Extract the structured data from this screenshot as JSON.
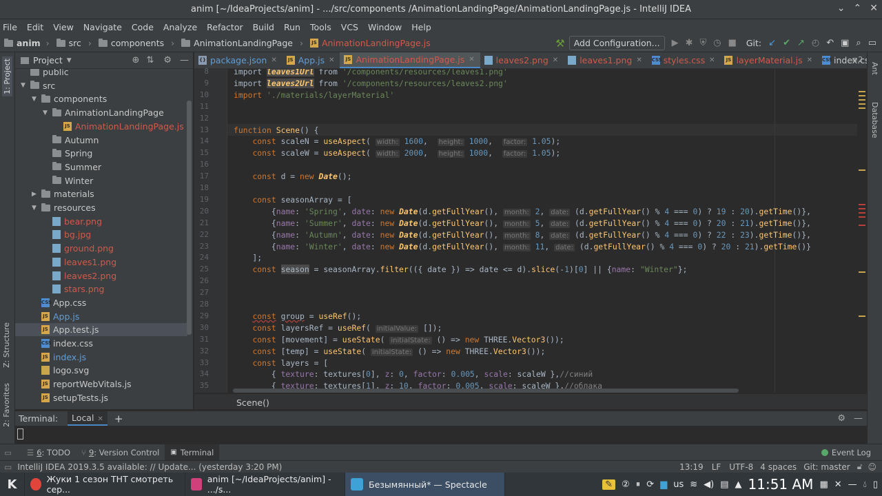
{
  "window": {
    "title": "anim [~/IdeaProjects/anim] - .../src/components /AnimationLandingPage/AnimationLandingPage.js - IntelliJ IDEA",
    "controls": [
      "⌄",
      "⌃",
      "✕"
    ]
  },
  "menu": [
    "File",
    "Edit",
    "View",
    "Navigate",
    "Code",
    "Analyze",
    "Refactor",
    "Build",
    "Run",
    "Tools",
    "VCS",
    "Window",
    "Help"
  ],
  "navbar": {
    "crumbs": [
      "anim",
      "src",
      "components",
      "AnimationLandingPage",
      "AnimationLandingPage.js"
    ],
    "add_configuration": "Add Configuration...",
    "git_label": "Git:"
  },
  "left_strip": {
    "project": "1: Project",
    "structure": "Z: Structure",
    "favorites": "2: Favorites"
  },
  "right_strip": {
    "ant": "Ant",
    "database": "Database"
  },
  "project_panel": {
    "title": "Project",
    "tree": [
      {
        "label": "public",
        "depth": 1,
        "kind": "folder",
        "color": "normal",
        "arrow": ""
      },
      {
        "label": "src",
        "depth": 1,
        "kind": "folder",
        "color": "normal",
        "arrow": "▼"
      },
      {
        "label": "components",
        "depth": 2,
        "kind": "folder",
        "color": "normal",
        "arrow": "▼"
      },
      {
        "label": "AnimationLandingPage",
        "depth": 3,
        "kind": "folder",
        "color": "normal",
        "arrow": "▼"
      },
      {
        "label": "AnimationLandingPage.js",
        "depth": 4,
        "kind": "js",
        "color": "red",
        "arrow": ""
      },
      {
        "label": "Autumn",
        "depth": 3,
        "kind": "folder",
        "color": "normal",
        "arrow": ""
      },
      {
        "label": "Spring",
        "depth": 3,
        "kind": "folder",
        "color": "normal",
        "arrow": ""
      },
      {
        "label": "Summer",
        "depth": 3,
        "kind": "folder",
        "color": "normal",
        "arrow": ""
      },
      {
        "label": "Winter",
        "depth": 3,
        "kind": "folder",
        "color": "normal",
        "arrow": ""
      },
      {
        "label": "materials",
        "depth": 2,
        "kind": "folder",
        "color": "normal",
        "arrow": "▶"
      },
      {
        "label": "resources",
        "depth": 2,
        "kind": "folder",
        "color": "normal",
        "arrow": "▼"
      },
      {
        "label": "bear.png",
        "depth": 3,
        "kind": "img",
        "color": "red",
        "arrow": ""
      },
      {
        "label": "bg.jpg",
        "depth": 3,
        "kind": "img",
        "color": "red",
        "arrow": ""
      },
      {
        "label": "ground.png",
        "depth": 3,
        "kind": "img",
        "color": "red",
        "arrow": ""
      },
      {
        "label": "leaves1.png",
        "depth": 3,
        "kind": "img",
        "color": "red",
        "arrow": ""
      },
      {
        "label": "leaves2.png",
        "depth": 3,
        "kind": "img",
        "color": "red",
        "arrow": ""
      },
      {
        "label": "stars.png",
        "depth": 3,
        "kind": "img",
        "color": "red",
        "arrow": ""
      },
      {
        "label": "App.css",
        "depth": 2,
        "kind": "css",
        "color": "normal",
        "arrow": ""
      },
      {
        "label": "App.js",
        "depth": 2,
        "kind": "js",
        "color": "blue",
        "arrow": ""
      },
      {
        "label": "App.test.js",
        "depth": 2,
        "kind": "js",
        "color": "normal",
        "arrow": "",
        "selected": true
      },
      {
        "label": "index.css",
        "depth": 2,
        "kind": "css",
        "color": "normal",
        "arrow": ""
      },
      {
        "label": "index.js",
        "depth": 2,
        "kind": "js",
        "color": "blue",
        "arrow": ""
      },
      {
        "label": "logo.svg",
        "depth": 2,
        "kind": "svg",
        "color": "normal",
        "arrow": ""
      },
      {
        "label": "reportWebVitals.js",
        "depth": 2,
        "kind": "js",
        "color": "normal",
        "arrow": ""
      },
      {
        "label": "setupTests.js",
        "depth": 2,
        "kind": "js",
        "color": "normal",
        "arrow": ""
      }
    ]
  },
  "tabs": [
    {
      "label": "package.json",
      "color": "blue",
      "kind": "json"
    },
    {
      "label": "App.js",
      "color": "blue",
      "kind": "js"
    },
    {
      "label": "AnimationLandingPage.js",
      "color": "red",
      "kind": "js",
      "active": true
    },
    {
      "label": "leaves2.png",
      "color": "red",
      "kind": "img"
    },
    {
      "label": "leaves1.png",
      "color": "red",
      "kind": "img"
    },
    {
      "label": "styles.css",
      "color": "red",
      "kind": "css"
    },
    {
      "label": "layerMaterial.js",
      "color": "red",
      "kind": "js"
    },
    {
      "label": "index.css",
      "color": "normal",
      "kind": "css"
    }
  ],
  "tabs_overflow": "≡2",
  "line_numbers": [
    8,
    9,
    10,
    11,
    12,
    13,
    14,
    15,
    16,
    17,
    18,
    19,
    20,
    21,
    22,
    23,
    24,
    25,
    26,
    27,
    28,
    29,
    30,
    31,
    32,
    33,
    34,
    35
  ],
  "code_lines": [
    "import <span class=\"hlv it\">leaves1Url</span> from <span class=\"str\">'/components/resources/leaves1.png'</span>",
    "import <span class=\"hlv it\">leaves2Url</span> from <span class=\"str\">'/components/resources/leaves2.png'</span>",
    "<span class=\"kw\">import</span> <span class=\"str\">'./materials/layerMaterial'</span>",
    "",
    "",
    "<span class=\"kw\">function</span> <span class=\"fn\">Scene</span>() {",
    "    <span class=\"kw\">const</span> scaleN = <span class=\"fn\">useAspect</span>( <span class=\"hint\">width:</span> <span class=\"num\">1600</span>,  <span class=\"hint\">height:</span> <span class=\"num\">1000</span>,  <span class=\"hint\">factor:</span> <span class=\"num\">1.05</span>);",
    "    <span class=\"kw\">const</span> scaleW = <span class=\"fn\">useAspect</span>( <span class=\"hint\">width:</span> <span class=\"num\">2000</span>,  <span class=\"hint\">height:</span> <span class=\"num\">1000</span>,  <span class=\"hint\">factor:</span> <span class=\"num\">1.05</span>);",
    "",
    "    <span class=\"kw\">const</span> d = <span class=\"kw\">new</span> <span class=\"it\">Date</span>();",
    "",
    "    <span class=\"kw\">const</span> seasonArray = [",
    "        {<span class=\"prop\">name</span>: <span class=\"str\">'Spring'</span>, <span class=\"prop\">date</span>: <span class=\"kw\">new</span> <span class=\"it\">Date</span>(d.<span class=\"fn\">getFullYear</span>(), <span class=\"hint\">month:</span> <span class=\"num\">2</span>, <span class=\"hint\">date:</span> (d.<span class=\"fn\">getFullYear</span>() % <span class=\"num\">4</span> === <span class=\"num\">0</span>) ? <span class=\"num\">19</span> : <span class=\"num\">20</span>).<span class=\"fn\">getTime</span>()},",
    "        {<span class=\"prop\">name</span>: <span class=\"str\">'Summer'</span>, <span class=\"prop\">date</span>: <span class=\"kw\">new</span> <span class=\"it\">Date</span>(d.<span class=\"fn\">getFullYear</span>(), <span class=\"hint\">month:</span> <span class=\"num\">5</span>, <span class=\"hint\">date:</span> (d.<span class=\"fn\">getFullYear</span>() % <span class=\"num\">4</span> === <span class=\"num\">0</span>) ? <span class=\"num\">20</span> : <span class=\"num\">21</span>).<span class=\"fn\">getTime</span>()},",
    "        {<span class=\"prop\">name</span>: <span class=\"str\">'Autumn'</span>, <span class=\"prop\">date</span>: <span class=\"kw\">new</span> <span class=\"it\">Date</span>(d.<span class=\"fn\">getFullYear</span>(), <span class=\"hint\">month:</span> <span class=\"num\">8</span>, <span class=\"hint\">date:</span> (d.<span class=\"fn\">getFullYear</span>() % <span class=\"num\">4</span> === <span class=\"num\">0</span>) ? <span class=\"num\">22</span> : <span class=\"num\">23</span>).<span class=\"fn\">getTime</span>()},",
    "        {<span class=\"prop\">name</span>: <span class=\"str\">'Winter'</span>, <span class=\"prop\">date</span>: <span class=\"kw\">new</span> <span class=\"it\">Date</span>(d.<span class=\"fn\">getFullYear</span>(), <span class=\"hint\">month:</span> <span class=\"num\">11</span>, <span class=\"hint\">date:</span> (d.<span class=\"fn\">getFullYear</span>() % <span class=\"num\">4</span> === <span class=\"num\">0</span>) ? <span class=\"num\">20</span> : <span class=\"num\">21</span>).<span class=\"fn\">getTime</span>()}",
    "    ];",
    "    <span class=\"kw\">const</span> <span class=\"hlv\">season</span> = seasonArray.<span class=\"fn\">filter</span>(({ date }) => date <= d).<span class=\"fn\">slice</span>(-<span class=\"num\">1</span>)[<span class=\"num\">0</span>] || {<span class=\"prop\">name</span>: <span class=\"str\">\"Winter\"</span>};",
    "",
    "",
    "",
    "    <span class=\"kw und\">const</span> <span class=\"und\">group</span> = <span class=\"fn\">useRef</span>();",
    "    <span class=\"kw\">const</span> layersRef = <span class=\"fn\">useRef</span>( <span class=\"hint\">initialValue:</span> []);",
    "    <span class=\"kw\">const</span> [movement] = <span class=\"fn\">useState</span>( <span class=\"hint\">initialState:</span> () => <span class=\"kw\">new</span> THREE.<span class=\"fn\">Vector3</span>());",
    "    <span class=\"kw\">const</span> [temp] = <span class=\"fn\">useState</span>( <span class=\"hint\">initialState:</span> () => <span class=\"kw\">new</span> THREE.<span class=\"fn\">Vector3</span>());",
    "    <span class=\"kw\">const</span> layers = [",
    "        { <span class=\"prop\">texture</span>: textures[<span class=\"num\">0</span>], <span class=\"prop\">z</span>: <span class=\"num\">0</span>, <span class=\"prop\">factor</span>: <span class=\"num\">0.005</span>, <span class=\"prop\">scale</span>: scaleW },<span class=\"cmt\">//синий</span>",
    "        { <span class=\"prop\">texture</span>: textures[<span class=\"num\">1</span>], <span class=\"prop\">z</span>: <span class=\"num\">10</span>, <span class=\"prop\">factor</span>: <span class=\"num\">0.005</span>, <span class=\"prop\">scale</span>: scaleW },<span class=\"cmt\">//облака</span>"
  ],
  "editor_breadcrumb": "Scene()",
  "terminal": {
    "title": "Terminal:",
    "tab": "Local"
  },
  "tool_windows": [
    {
      "num": "6",
      "label": ": TODO"
    },
    {
      "num": "9",
      "label": ": Version Control"
    },
    {
      "num": "",
      "label": "Terminal",
      "active": true
    }
  ],
  "event_log": "Event Log",
  "status": {
    "message": "IntelliJ IDEA 2019.3.5 available: // Update... (yesterday 3:20 PM)",
    "position": "13:19",
    "line_sep": "LF",
    "encoding": "UTF-8",
    "indent": "4 spaces",
    "vcs": "Git: master"
  },
  "taskbar": {
    "apps": [
      {
        "label": "Жуки 1 сезон ТНТ смотреть сер...",
        "color": "#e0443a"
      },
      {
        "label": "anim [~/IdeaProjects/anim] - .../s...",
        "color": "#d0417b"
      },
      {
        "label": "Безымянный* — Spectacle",
        "color": "#3ea2d6",
        "active": true
      }
    ],
    "lang": "us",
    "clock": "11:51 AM"
  }
}
